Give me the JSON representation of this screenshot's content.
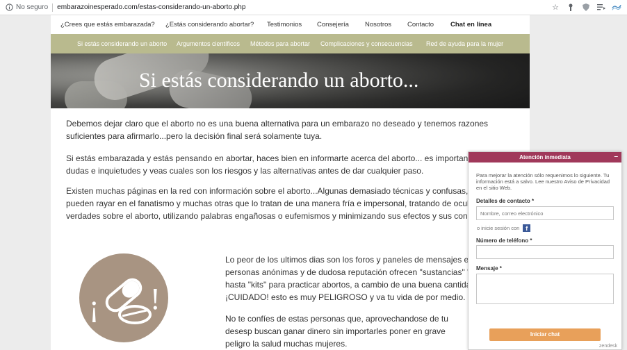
{
  "browser": {
    "security_label": "No seguro",
    "url": "embarazoinesperado.com/estas-considerando-un-aborto.php"
  },
  "topnav": [
    "¿Crees que estás embarazada?",
    "¿Estás considerando abortar?",
    "Testimonios",
    "Consejería",
    "Nosotros",
    "Contacto",
    "Chat en línea"
  ],
  "subnav": [
    "Si estás considerando un aborto",
    "Argumentos científicos",
    "Métodos para abortar",
    "Complicaciones y consecuencias",
    "Red de ayuda para la mujer"
  ],
  "hero_title": "Si estás considerando un aborto...",
  "paragraphs": [
    "Debemos dejar claro que el aborto no es una buena alternativa para un embarazo no deseado y tenemos razones suficientes para afirmarlo...pero la decisión final será solamente tuya.",
    "Si estás embarazada y estás pensando en abortar, haces bien en informarte acerca del aborto... es importante que dudas e inquietudes y veas cuales son los riesgos y las alternativas antes de dar cualquier paso.",
    "Existen muchas páginas en la red con información sobre el aborto...Algunas demasiado técnicas y confusas, otras pueden rayar en el fanatismo y muchas otras que lo tratan de una manera fría e impersonal, tratando de ocultar a verdades sobre el aborto, utilizando palabras engañosas o eufemismos y minimizando sus efectos y sus consecu",
    "Lo peor de los ultimos dias son los foros y paneles de mensajes en d personas anónimas y de dudosa reputación ofrecen \"sustancias\" \"pa hasta \"kits\" para practicar abortos, a cambio de una buena cantidad ¡CUIDADO! esto es muy PELIGROSO y va tu vida de por medio.",
    "No te confíes de estas personas que, aprovechandose de tu desesp buscan ganar dinero sin importarles poner en grave peligro la salud muchas mujeres."
  ],
  "image_glyphs": {
    "open": "¡",
    "close": "!"
  },
  "chat": {
    "header": "Atención inmediata",
    "minimize": "–",
    "intro": "Para mejorar la atención sólo requenimos lo siguiente. Tu información está a salvo. Lee nuestro Aviso de Privacidad en el sitio Web.",
    "contact_label": "Detalles de contacto *",
    "contact_placeholder": "Nombre, correo electrónico",
    "or_login": "o inicie sesión con",
    "phone_label": "Número de teléfono *",
    "message_label": "Mensaje *",
    "start_button": "Iniciar chat",
    "brand": "zendesk"
  },
  "colors": {
    "subnav_bg": "#b9ba8e",
    "chat_header": "#a0385a",
    "chat_button": "#e8a05a",
    "circle_bg": "#a89482"
  }
}
